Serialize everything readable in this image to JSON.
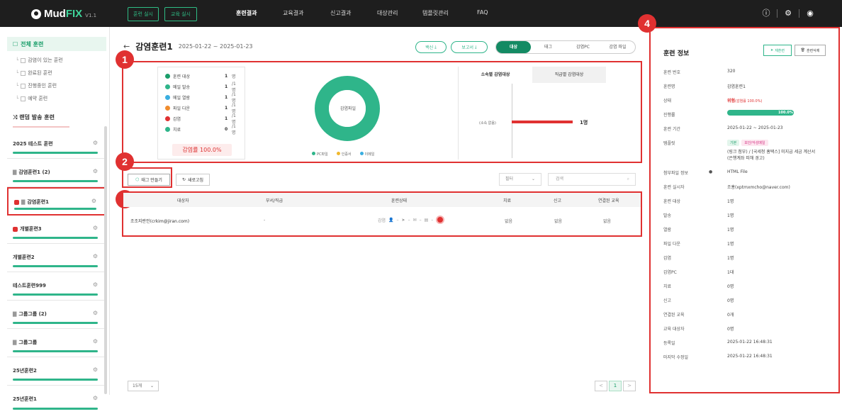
{
  "app": {
    "brand": "MudFIX",
    "brand_mud": "Mud",
    "brand_fix": "FIX",
    "version": "V1.1"
  },
  "topbar": {
    "btn_training": "훈련 실시",
    "btn_education": "교육 실시",
    "nav": [
      "훈련결과",
      "교육결과",
      "신고결과",
      "대상관리",
      "템플릿관리",
      "FAQ"
    ],
    "active_nav": "훈련결과",
    "icons": [
      "info-icon",
      "gear-icon",
      "user-icon"
    ]
  },
  "sidebar": {
    "all": "전체 훈련",
    "sub_items": [
      "감염이 있는 훈련",
      "완료된 훈련",
      "진행중인 훈련",
      "예약 훈련"
    ],
    "random": "랜덤 발송 훈련",
    "groups": [
      {
        "name": "2025 테스트 훈련",
        "folder": false,
        "badge": false
      },
      {
        "name": "감염훈련1 (2)",
        "folder": true,
        "badge": false
      },
      {
        "name": "감염훈련1",
        "folder": true,
        "badge": true
      },
      {
        "name": "개별훈련3",
        "folder": false,
        "badge": true
      },
      {
        "name": "개별훈련2",
        "folder": false,
        "badge": false
      },
      {
        "name": "테스트훈련999",
        "folder": false,
        "badge": false
      },
      {
        "name": "그룹그룹 (2)",
        "folder": true,
        "badge": false
      },
      {
        "name": "그룹그룹",
        "folder": true,
        "badge": false
      },
      {
        "name": "25년훈련2",
        "folder": false,
        "badge": false
      },
      {
        "name": "25년훈련1",
        "folder": false,
        "badge": false
      }
    ]
  },
  "main": {
    "title": "감염훈련1",
    "date_range": "2025-01-22 ~ 2025-01-23",
    "btn_backup": "백신",
    "btn_report": "보고서",
    "tabs": [
      "대상",
      "태그",
      "감염PC",
      "감염 파일"
    ],
    "active_tab": "대상"
  },
  "stats": {
    "rows": [
      {
        "label": "훈련 대상",
        "value": "1",
        "unit": "명",
        "color": "#1a9e6a"
      },
      {
        "label": "메일 발송",
        "value": "1",
        "unit": "/1명",
        "color": "#2fb58a"
      },
      {
        "label": "메일 열람",
        "value": "1",
        "unit": "/1명",
        "color": "#3aaee0"
      },
      {
        "label": "파일 다운",
        "value": "1",
        "unit": "/1명",
        "color": "#f08c2e"
      },
      {
        "label": "감염",
        "value": "1",
        "unit": "/1명",
        "color": "#e03131"
      },
      {
        "label": "치료",
        "value": "0",
        "unit": "/1명",
        "color": "#2fb58a"
      }
    ],
    "infect_rate": "감염률 100.0%"
  },
  "donut": {
    "center": "감염파일",
    "legend": [
      {
        "label": "PC파일",
        "color": "#2fb58a"
      },
      {
        "label": "인증서",
        "color": "#f0b82e"
      },
      {
        "label": "이메일",
        "color": "#3aaee0"
      }
    ],
    "segments": [
      {
        "value": 100,
        "color": "#2fb58a"
      }
    ]
  },
  "chart_data": {
    "type": "bar",
    "orientation": "horizontal",
    "tabs": [
      "소속별 감염대상",
      "직급별 감염대상"
    ],
    "active_tab": "소속별 감염대상",
    "categories": [
      "(소속 없음)"
    ],
    "values": [
      1
    ],
    "value_labels": [
      "1명"
    ],
    "bar_color": "#e03131"
  },
  "toolbar": {
    "tag_btn": "태그 만들기",
    "refresh_btn": "새로고침",
    "filter": "필터",
    "search_placeholder": "검색"
  },
  "table": {
    "headers": [
      "대상자",
      "부서/직급",
      "훈련상태",
      "치료",
      "신고",
      "연결된 교육"
    ],
    "rows": [
      {
        "target": "조조지란인(crkim@jiran.com)",
        "dept": "-",
        "status": "감염",
        "treat": "없음",
        "report": "없음",
        "edu": "없음"
      }
    ]
  },
  "pager": {
    "size": "15개",
    "prev": "<",
    "current": "1",
    "next": ">"
  },
  "markers": [
    "1",
    "2",
    "3",
    "4"
  ],
  "info": {
    "title": "훈련 정보",
    "retrain": "재훈련",
    "delete": "훈련삭제",
    "rows": [
      {
        "label": "훈련 번호",
        "value": "320"
      },
      {
        "label": "훈련명",
        "value": "감염훈련1"
      },
      {
        "label": "상태",
        "value": "위험",
        "extra": "(감염률 100.0%)"
      },
      {
        "label": "진행률",
        "value": "100.0%",
        "progress": 1.0
      },
      {
        "label": "훈련 기간",
        "value": "2025-01-22 ~ 2025-01-23"
      },
      {
        "label": "템플릿",
        "chips": [
          "기본",
          "보안/악성메일"
        ],
        "value": "(링크 첨부) / [국세청 홈택스] 미지급 세금 계산서",
        "value2": "(은행계좌 피해 경고)"
      },
      {
        "label": "첨부파일 정보",
        "value": "HTML File"
      },
      {
        "label": "훈련 실시자",
        "value": "조홍(xptmxmcho@naver.com)"
      },
      {
        "label": "훈련 대상",
        "value": "1명"
      },
      {
        "label": "발송",
        "value": "1명"
      },
      {
        "label": "열람",
        "value": "1명"
      },
      {
        "label": "파일 다운",
        "value": "1명"
      },
      {
        "label": "감염",
        "value": "1명"
      },
      {
        "label": "감염PC",
        "value": "1대"
      },
      {
        "label": "치료",
        "value": "0명"
      },
      {
        "label": "신고",
        "value": "0명"
      },
      {
        "label": "연결된 교육",
        "value": "0개"
      },
      {
        "label": "교육 대상자",
        "value": "0명"
      },
      {
        "label": "등록일",
        "value": "2025-01-22 16:48:31"
      },
      {
        "label": "마지막 수정일",
        "value": "2025-01-22 16:48:31"
      }
    ]
  }
}
